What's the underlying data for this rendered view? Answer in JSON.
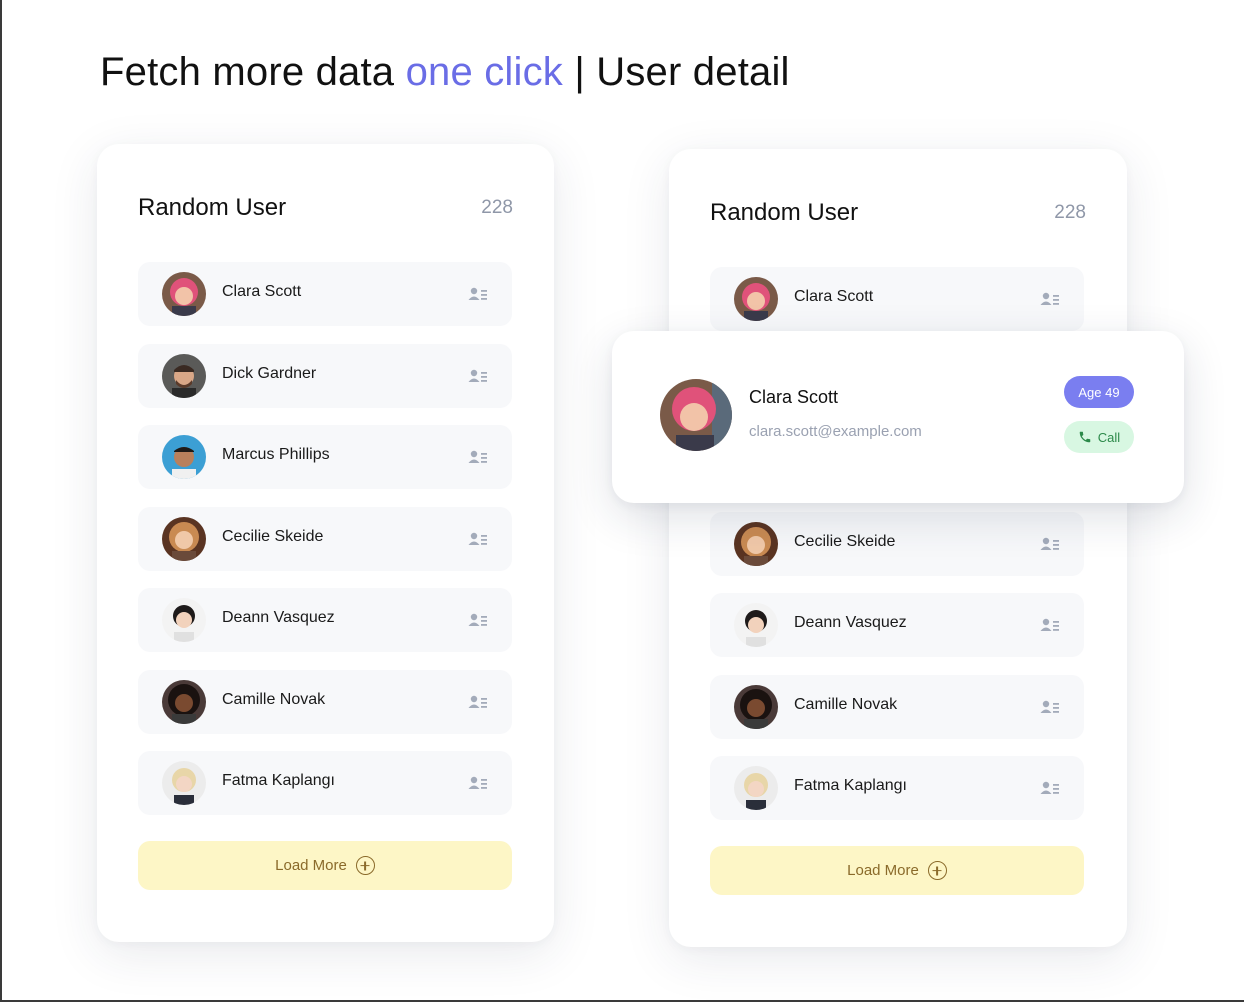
{
  "headline": {
    "part1": "Fetch more data ",
    "accent": "one click",
    "part2": " | User detail"
  },
  "colors": {
    "accent": "#6a6de6",
    "load_more_bg": "#fdf6c6",
    "age_badge_bg": "#7a7ef0",
    "call_bg": "#d8f7e2"
  },
  "left_card": {
    "title": "Random User",
    "count": "228",
    "users": [
      {
        "name": "Clara Scott",
        "icon": "user-details-icon"
      },
      {
        "name": "Dick Gardner",
        "icon": "user-details-icon"
      },
      {
        "name": "Marcus Phillips",
        "icon": "user-details-icon"
      },
      {
        "name": "Cecilie Skeide",
        "icon": "user-details-icon"
      },
      {
        "name": "Deann Vasquez",
        "icon": "user-details-icon"
      },
      {
        "name": "Camille Novak",
        "icon": "user-details-icon"
      },
      {
        "name": "Fatma Kaplangı",
        "icon": "user-details-icon"
      }
    ],
    "load_more_label": "Load More"
  },
  "right_card": {
    "title": "Random User",
    "count": "228",
    "users": [
      {
        "name": "Clara Scott"
      },
      {
        "name": "Cecilie Skeide"
      },
      {
        "name": "Deann Vasquez"
      },
      {
        "name": "Camille Novak"
      },
      {
        "name": "Fatma Kaplangı"
      }
    ],
    "load_more_label": "Load More"
  },
  "detail": {
    "name": "Clara Scott",
    "email": "clara.scott@example.com",
    "age_label": "Age 49",
    "call_label": "Call",
    "call_icon": "phone-icon"
  }
}
